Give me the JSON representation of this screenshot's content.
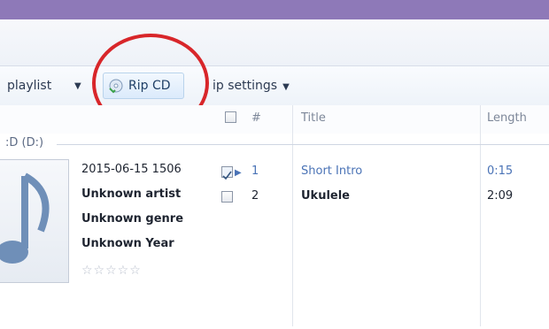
{
  "toolbar": {
    "playlist_label": "playlist",
    "rip_cd_label": "Rip CD",
    "rip_settings_label": "ip settings"
  },
  "columns": {
    "number": "#",
    "title": "Title",
    "length": "Length"
  },
  "group": {
    "label": ":D (D:)"
  },
  "album": {
    "date": "2015-06-15 1506",
    "artist": "Unknown artist",
    "genre": "Unknown genre",
    "year": "Unknown Year",
    "rating": 0
  },
  "tracks": [
    {
      "checked": true,
      "number": "1",
      "title": "Short Intro",
      "length": "0:15",
      "playing": true
    },
    {
      "checked": false,
      "number": "2",
      "title": "Ukulele",
      "length": "2:09",
      "playing": false
    }
  ],
  "colors": {
    "title_bar": "#8e79b8",
    "annotation_circle": "#d8262a",
    "playing_text": "#4a73b6"
  },
  "icons": {
    "rip": "rip-cd-icon",
    "album": "music-note-icon",
    "dropdown": "chevron-down-icon"
  }
}
